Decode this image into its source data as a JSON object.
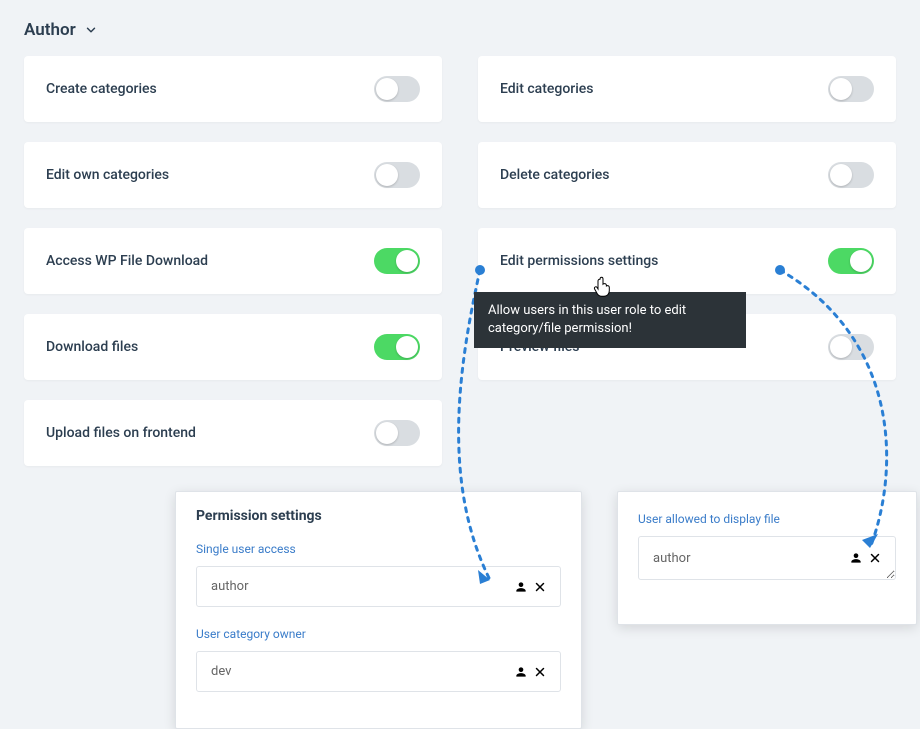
{
  "role_dropdown": {
    "label": "Author"
  },
  "permissions": [
    {
      "label": "Create categories",
      "on": false
    },
    {
      "label": "Edit categories",
      "on": false
    },
    {
      "label": "Edit own categories",
      "on": false
    },
    {
      "label": "Delete categories",
      "on": false
    },
    {
      "label": "Access WP File Download",
      "on": true
    },
    {
      "label": "Edit permissions settings",
      "on": true
    },
    {
      "label": "Download files",
      "on": true
    },
    {
      "label": "Preview files",
      "on": false
    },
    {
      "label": "Upload files on frontend",
      "on": false
    }
  ],
  "tooltip": {
    "text": "Allow users in this user role to edit category/file permission!"
  },
  "permission_settings_panel": {
    "title": "Permission settings",
    "single_user_access": {
      "label": "Single user access",
      "value": "author"
    },
    "user_category_owner": {
      "label": "User category owner",
      "value": "dev"
    }
  },
  "user_allowed_panel": {
    "title": "User allowed to display file",
    "value": "author"
  }
}
